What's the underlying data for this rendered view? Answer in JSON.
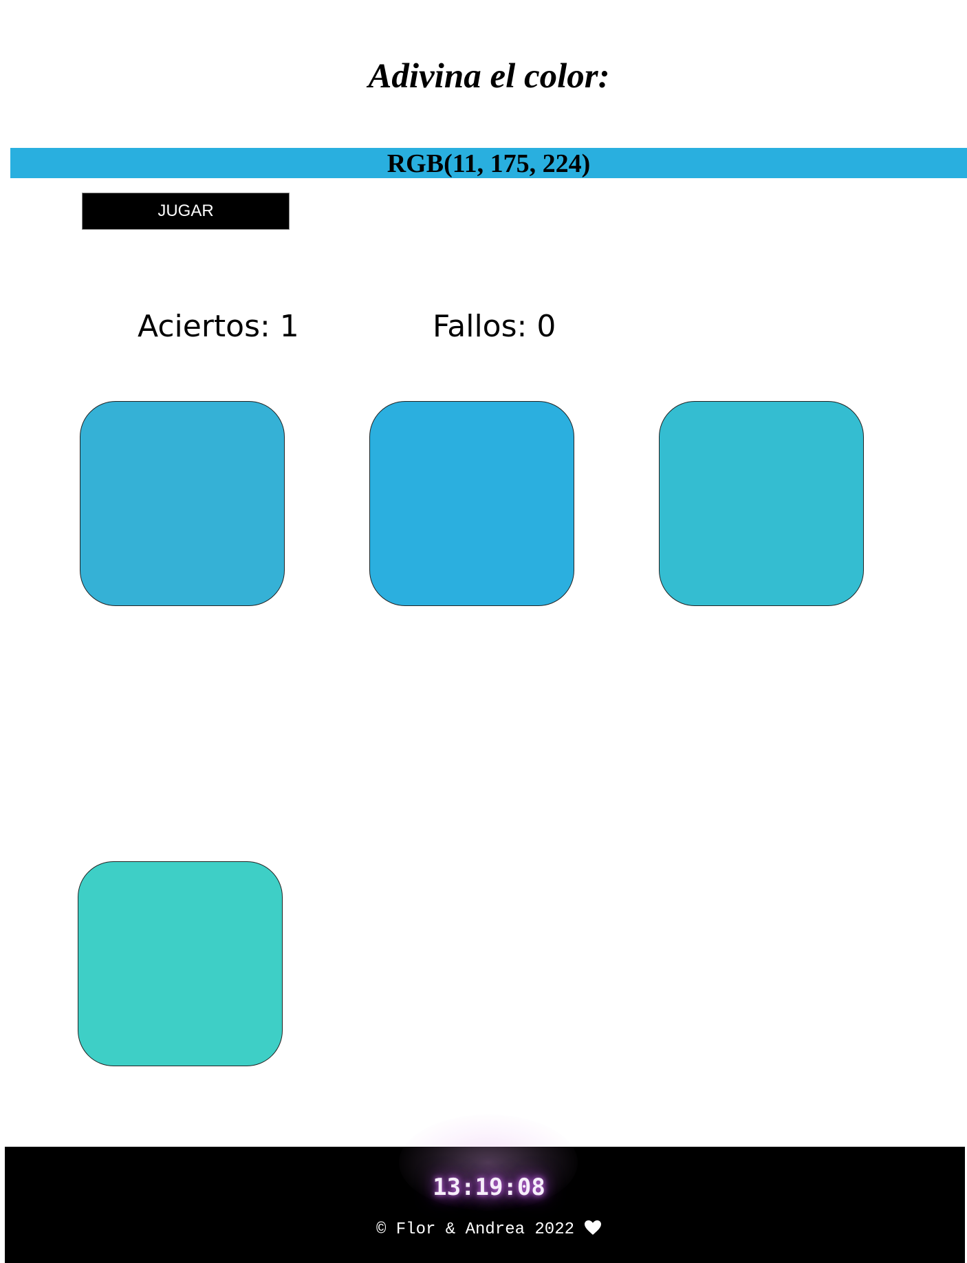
{
  "header": {
    "title": "Adivina el color:"
  },
  "target": {
    "rgb_label": "RGB(11, 175, 224)"
  },
  "controls": {
    "play_label": "JUGAR"
  },
  "score": {
    "hits_label": "Aciertos: 1",
    "misses_label": "Fallos: 0"
  },
  "swatches": [
    {
      "color": "#35b1d6"
    },
    {
      "color": "#2bafdf"
    },
    {
      "color": "#34bdd1"
    },
    {
      "color": "#3ecfc6"
    }
  ],
  "footer": {
    "clock": "13:19:08",
    "copyright": "© Flor & Andrea 2022",
    "heart_icon": "heart-icon"
  }
}
